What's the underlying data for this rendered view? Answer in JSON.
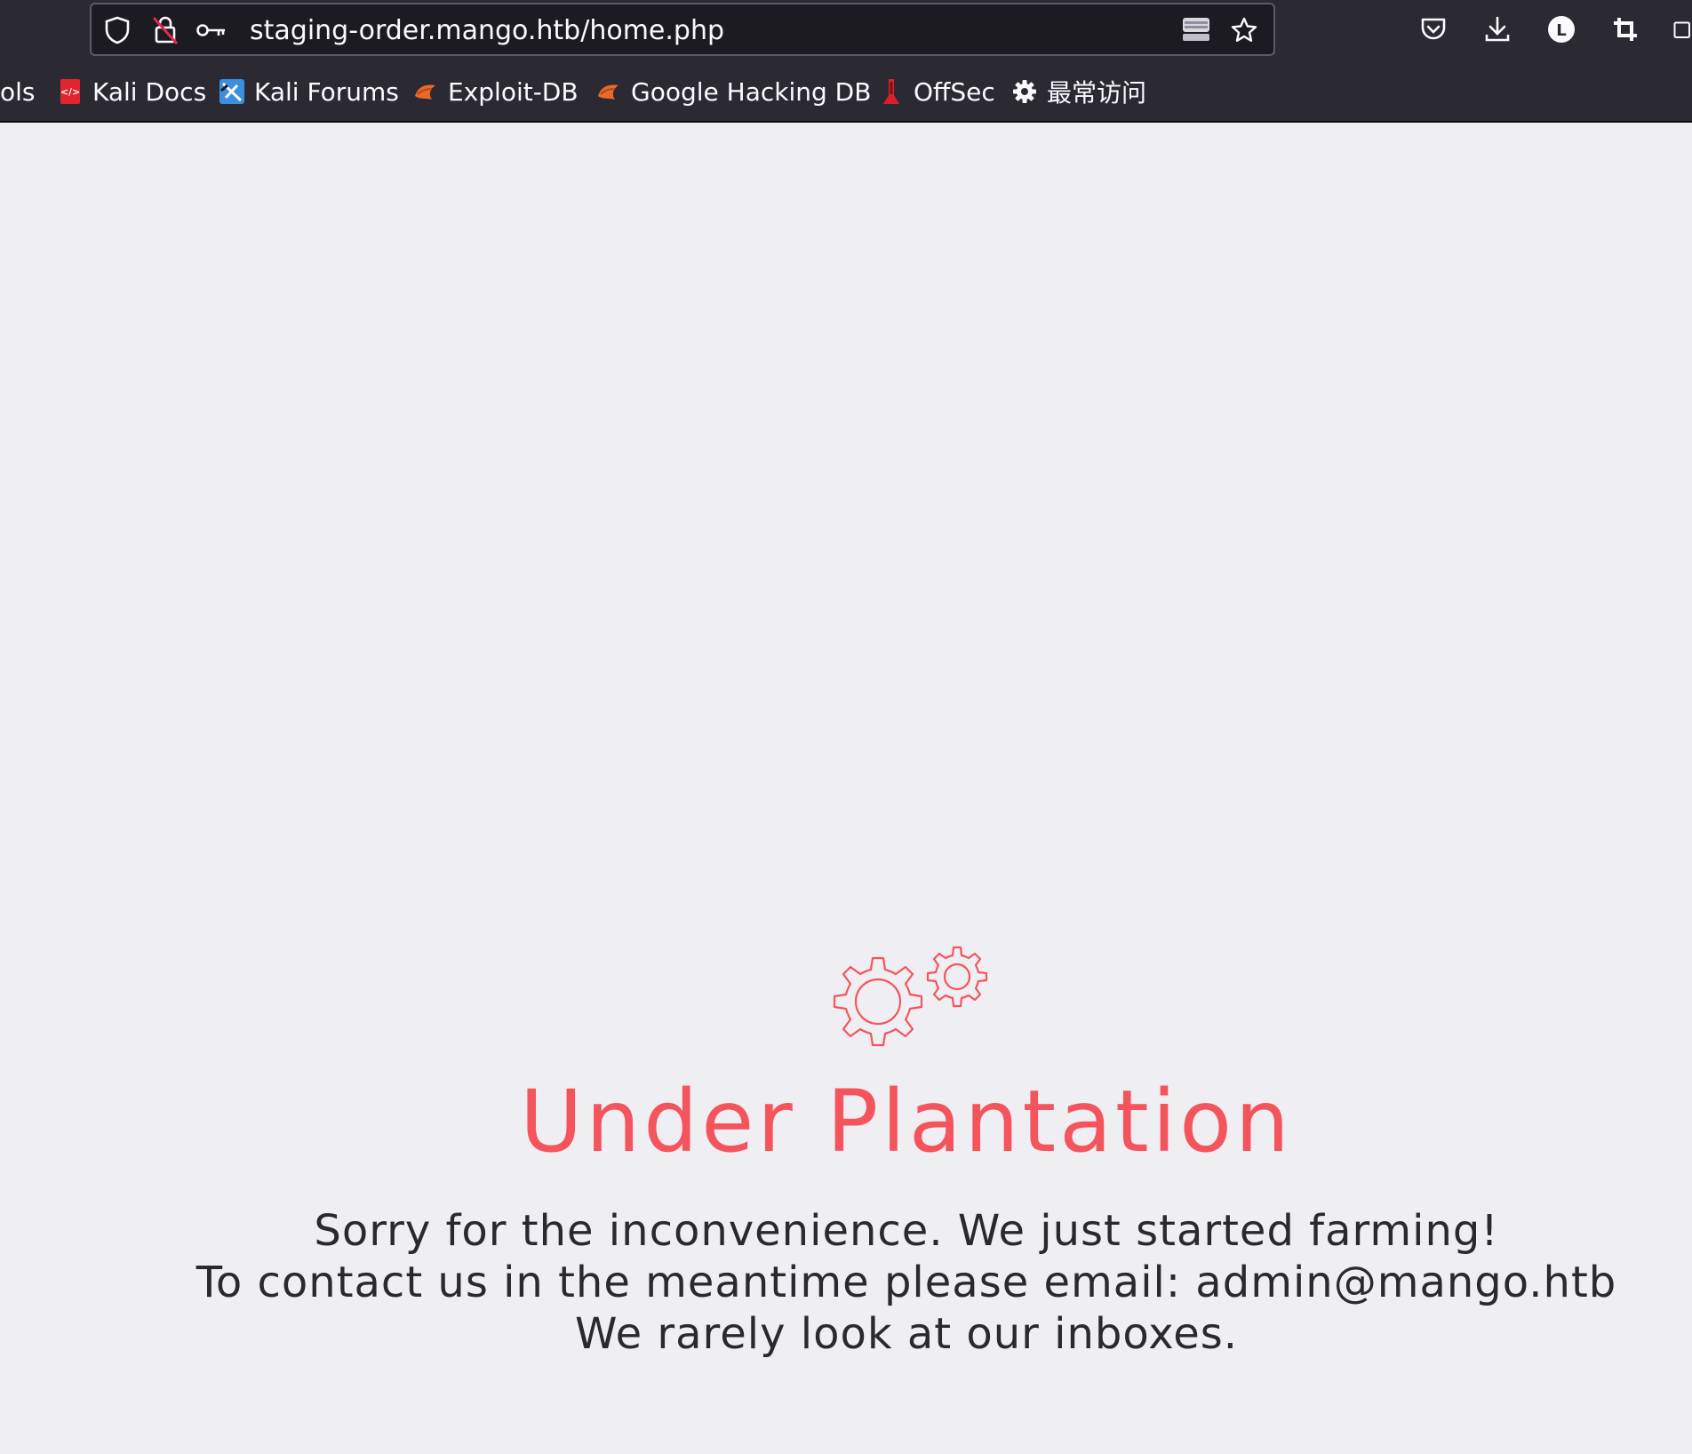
{
  "browser": {
    "url": "staging-order.mango.htb/home.php",
    "toolbar_icons": [
      "shield-icon",
      "connection-not-secure-icon",
      "key-icon",
      "reader-view-icon",
      "bookmark-star-icon",
      "pocket-icon",
      "downloads-icon",
      "account-icon",
      "crop-extension-icon"
    ],
    "bookmarks": [
      {
        "label": "ols",
        "icon": "none"
      },
      {
        "label": "Kali Docs",
        "icon": "kali-docs-icon"
      },
      {
        "label": "Kali Forums",
        "icon": "kali-forums-icon"
      },
      {
        "label": "Exploit-DB",
        "icon": "exploit-db-icon"
      },
      {
        "label": "Google Hacking DB",
        "icon": "ghdb-icon"
      },
      {
        "label": "OffSec",
        "icon": "offsec-icon"
      },
      {
        "label": "最常访问",
        "icon": "gear-icon"
      }
    ]
  },
  "page": {
    "icon": "gears-icon",
    "title": "Under Plantation",
    "lines": [
      "Sorry for the inconvenience. We just started farming!",
      "To contact us in the meantime please email: admin@mango.htb",
      "We rarely look at our inboxes."
    ],
    "accent_color": "#f4545c"
  }
}
